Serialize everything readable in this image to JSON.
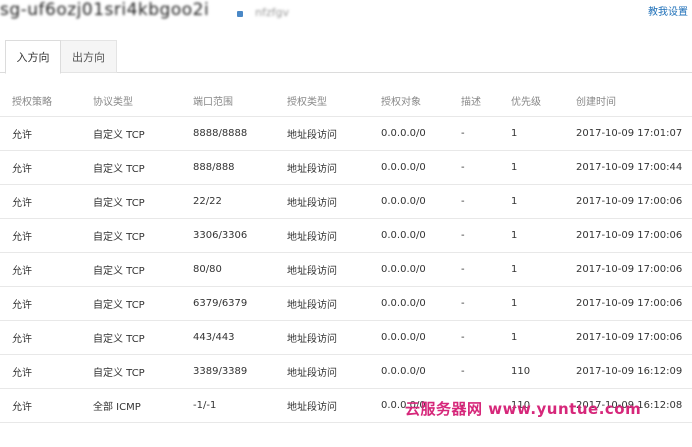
{
  "header": {
    "instance_id_blurred": "sg-uf6ozj01sri4kbgoo2i",
    "instance_name_blurred": "nfzfgv",
    "help_link": "教我设置"
  },
  "tabs": [
    {
      "label": "入方向",
      "active": true
    },
    {
      "label": "出方向",
      "active": false
    }
  ],
  "table": {
    "columns": [
      "授权策略",
      "协议类型",
      "端口范围",
      "授权类型",
      "授权对象",
      "描述",
      "优先级",
      "创建时间"
    ],
    "rows": [
      [
        "允许",
        "自定义 TCP",
        "8888/8888",
        "地址段访问",
        "0.0.0.0/0",
        "-",
        "1",
        "2017-10-09 17:01:07"
      ],
      [
        "允许",
        "自定义 TCP",
        "888/888",
        "地址段访问",
        "0.0.0.0/0",
        "-",
        "1",
        "2017-10-09 17:00:44"
      ],
      [
        "允许",
        "自定义 TCP",
        "22/22",
        "地址段访问",
        "0.0.0.0/0",
        "-",
        "1",
        "2017-10-09 17:00:06"
      ],
      [
        "允许",
        "自定义 TCP",
        "3306/3306",
        "地址段访问",
        "0.0.0.0/0",
        "-",
        "1",
        "2017-10-09 17:00:06"
      ],
      [
        "允许",
        "自定义 TCP",
        "80/80",
        "地址段访问",
        "0.0.0.0/0",
        "-",
        "1",
        "2017-10-09 17:00:06"
      ],
      [
        "允许",
        "自定义 TCP",
        "6379/6379",
        "地址段访问",
        "0.0.0.0/0",
        "-",
        "1",
        "2017-10-09 17:00:06"
      ],
      [
        "允许",
        "自定义 TCP",
        "443/443",
        "地址段访问",
        "0.0.0.0/0",
        "-",
        "1",
        "2017-10-09 17:00:06"
      ],
      [
        "允许",
        "自定义 TCP",
        "3389/3389",
        "地址段访问",
        "0.0.0.0/0",
        "-",
        "110",
        "2017-10-09 16:12:09"
      ],
      [
        "允许",
        "全部 ICMP",
        "-1/-1",
        "地址段访问",
        "0.0.0.0/0",
        "-",
        "110",
        "2017-10-09 16:12:08"
      ]
    ]
  },
  "watermark": "云服务器网 www.yuntue.com"
}
